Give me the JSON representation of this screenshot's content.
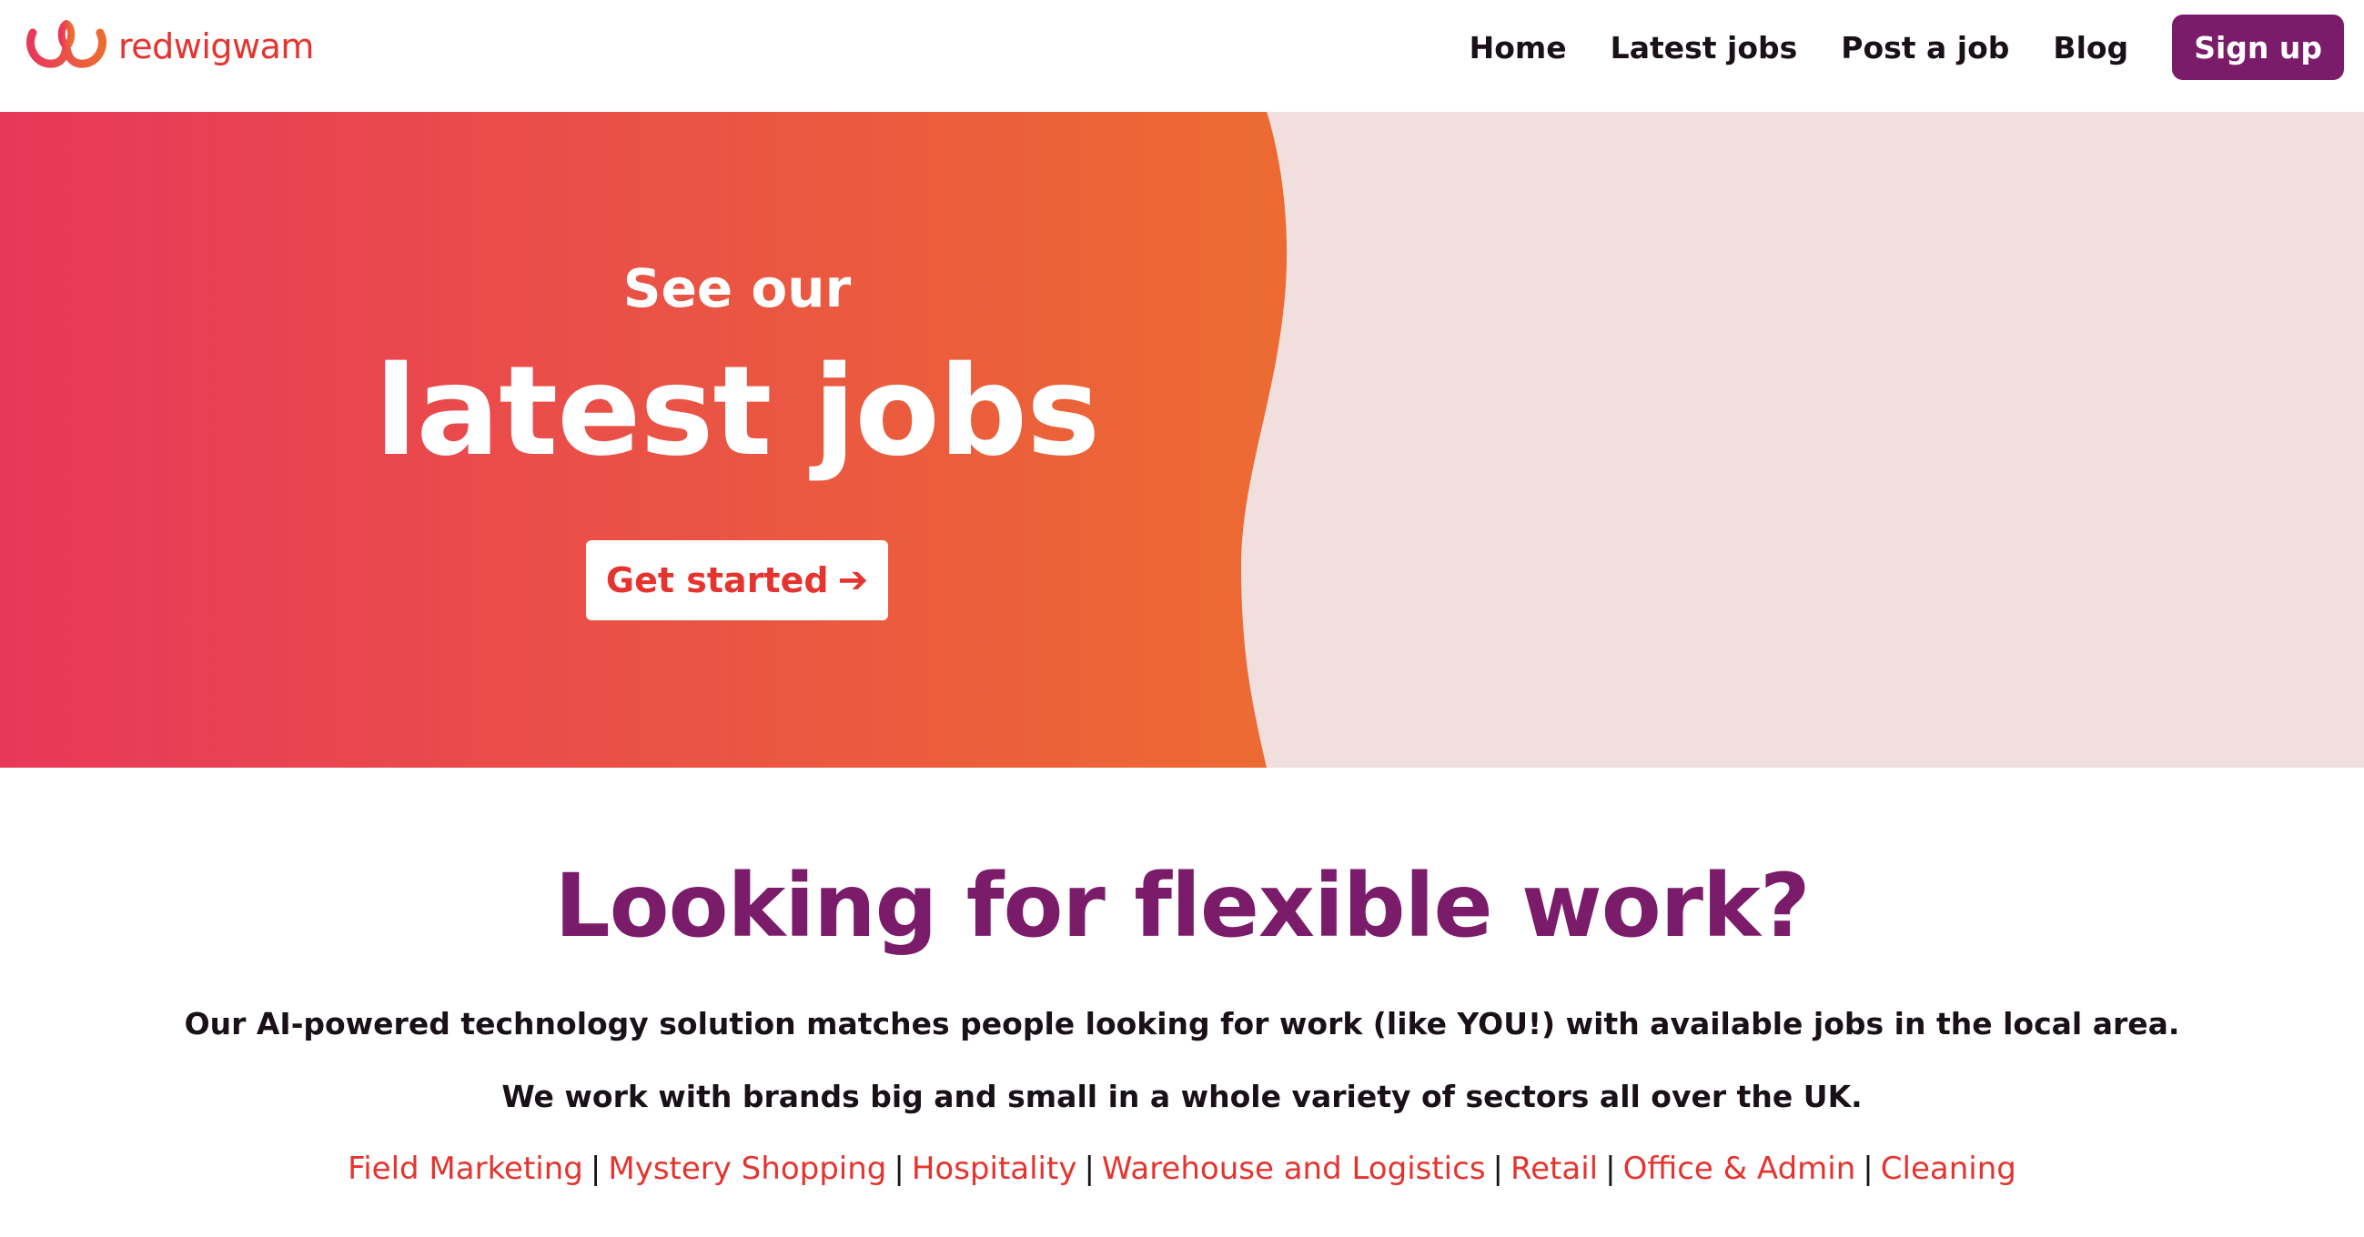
{
  "brand": {
    "name": "redwigwam",
    "logo_icon": "wigwam-logo-icon",
    "color": "#e5342f"
  },
  "nav": {
    "items": [
      {
        "label": "Home"
      },
      {
        "label": "Latest jobs"
      },
      {
        "label": "Post a job"
      },
      {
        "label": "Blog"
      }
    ],
    "signup_label": "Sign up",
    "signup_color": "#7b1c6b"
  },
  "hero": {
    "small_heading": "See our",
    "big_heading": "latest jobs",
    "cta_label": "Get started",
    "cta_icon": "arrow-right-icon",
    "gradient_from": "#e8385a",
    "gradient_to": "#ec6b32",
    "right_bg": "#f1dfdd"
  },
  "intro": {
    "title": "Looking for flexible work?",
    "paragraph_1": "Our AI-powered technology solution matches people looking for work (like YOU!) with available jobs in the local area.",
    "paragraph_2": "We work with brands big and small in a whole variety of sectors all over the UK.",
    "sectors": [
      "Field Marketing",
      "Mystery Shopping",
      "Hospitality",
      "Warehouse and Logistics",
      "Retail",
      "Office & Admin",
      "Cleaning"
    ],
    "separator": "|"
  }
}
